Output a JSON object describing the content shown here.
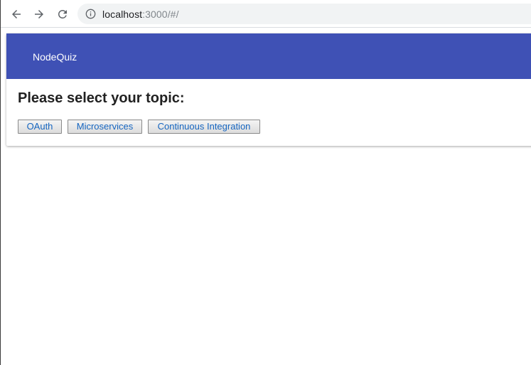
{
  "browser": {
    "url_host": "localhost",
    "url_path": ":3000/#/",
    "back_icon": "arrow-left-icon",
    "forward_icon": "arrow-right-icon",
    "reload_icon": "reload-icon",
    "info_icon": "info-icon"
  },
  "app": {
    "title": "NodeQuiz",
    "accent_color": "#3f51b5",
    "heading": "Please select your topic:",
    "topics": [
      {
        "label": "OAuth"
      },
      {
        "label": "Microservices"
      },
      {
        "label": "Continuous Integration"
      }
    ]
  }
}
